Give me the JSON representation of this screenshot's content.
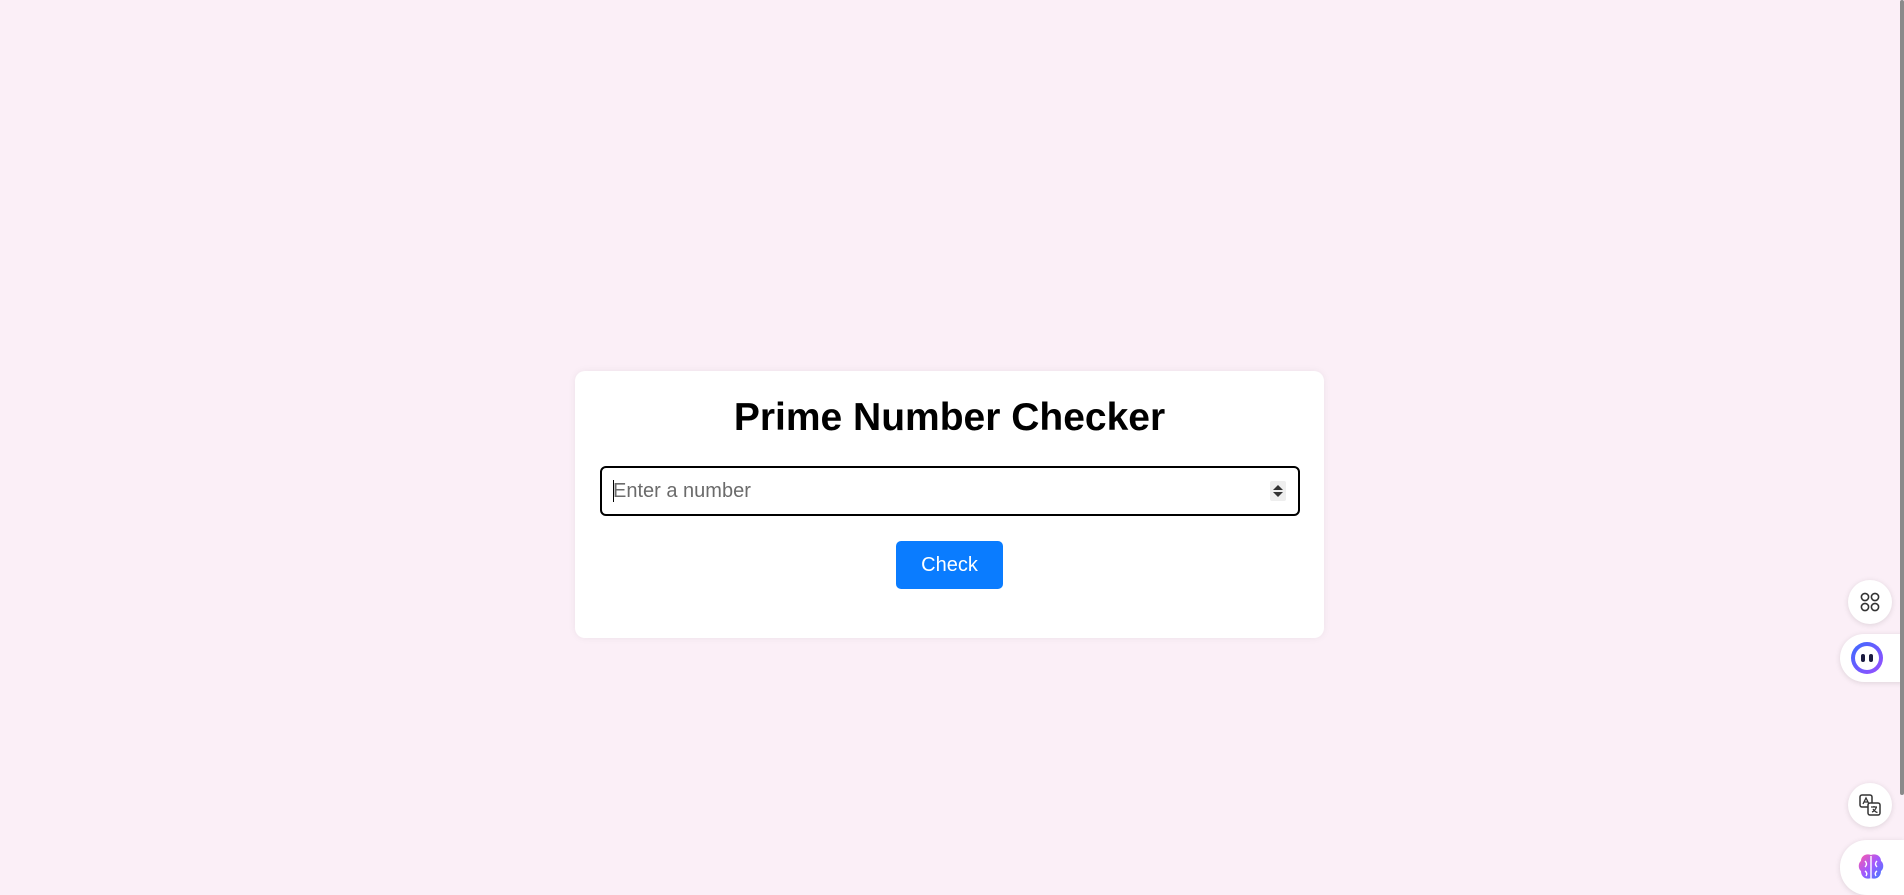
{
  "app": {
    "title": "Prime Number Checker"
  },
  "form": {
    "number_input": {
      "placeholder": "Enter a number",
      "value": ""
    },
    "check_label": "Check"
  },
  "colors": {
    "page_background": "#fbeff7",
    "card_background": "#ffffff",
    "button_accent": "#0a7cff"
  },
  "side_widgets": {
    "icons": [
      "apps-grid-icon",
      "assistant-face-icon",
      "translate-icon",
      "brain-icon"
    ]
  }
}
